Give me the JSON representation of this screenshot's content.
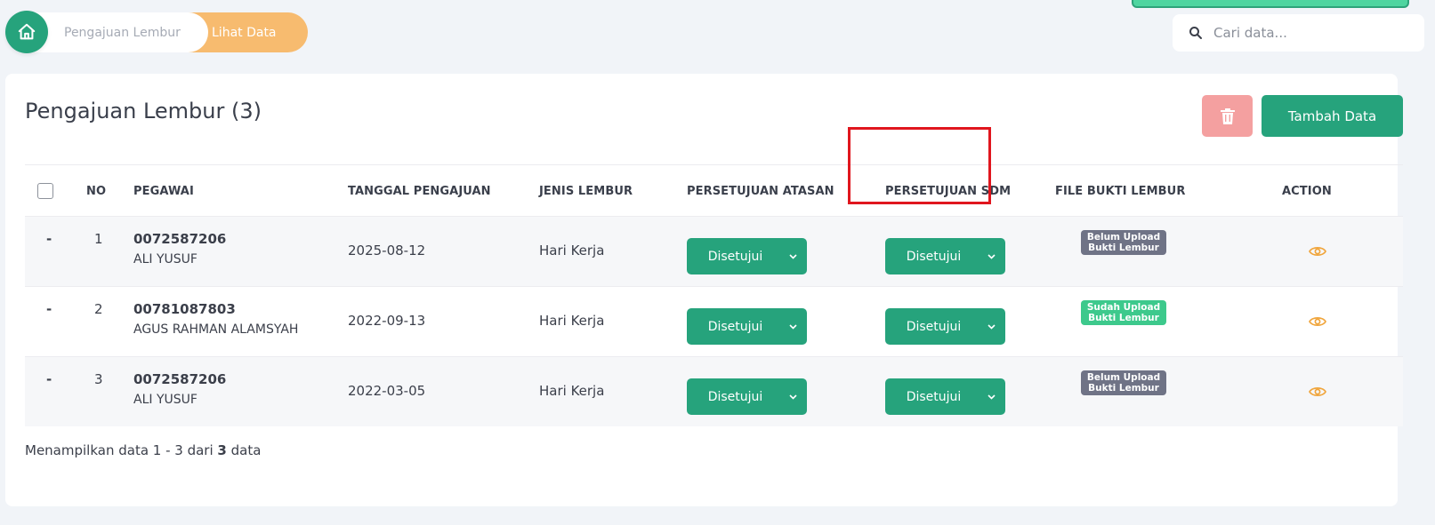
{
  "breadcrumb": {
    "items": [
      {
        "label": "Pengajuan Lembur"
      },
      {
        "label": "Lihat Data"
      }
    ]
  },
  "search": {
    "placeholder": "Cari data..."
  },
  "page": {
    "title": "Pengajuan Lembur (3)",
    "add_button_label": "Tambah Data"
  },
  "table": {
    "headers": {
      "no": "NO",
      "pegawai": "PEGAWAI",
      "tanggal": "TANGGAL PENGAJUAN",
      "jenis": "JENIS LEMBUR",
      "atasan": "PERSETUJUAN ATASAN",
      "sdm": "PERSETUJUAN SDM",
      "bukti": "FILE BUKTI LEMBUR",
      "action": "ACTION"
    },
    "rows": [
      {
        "dash": "-",
        "no": "1",
        "id": "0072587206",
        "name": "ALI YUSUF",
        "date": "2025-08-12",
        "type": "Hari Kerja",
        "atasan": "Disetujui",
        "sdm": "Disetujui",
        "bukti_line1": "Belum Upload",
        "bukti_line2": "Bukti Lembur",
        "bukti_status": "belum"
      },
      {
        "dash": "-",
        "no": "2",
        "id": "00781087803",
        "name": "AGUS RAHMAN ALAMSYAH",
        "date": "2022-09-13",
        "type": "Hari Kerja",
        "atasan": "Disetujui",
        "sdm": "Disetujui",
        "bukti_line1": "Sudah Upload",
        "bukti_line2": "Bukti Lembur",
        "bukti_status": "sudah"
      },
      {
        "dash": "-",
        "no": "3",
        "id": "0072587206",
        "name": "ALI YUSUF",
        "date": "2022-03-05",
        "type": "Hari Kerja",
        "atasan": "Disetujui",
        "sdm": "Disetujui",
        "bukti_line1": "Belum Upload",
        "bukti_line2": "Bukti Lembur",
        "bukti_status": "belum"
      }
    ]
  },
  "footer": {
    "prefix": "Menampilkan data 1 - 3 dari",
    "total": "3",
    "suffix": "data"
  },
  "colors": {
    "primary": "#26a37c",
    "breadcrumb_active": "#f7bb6f",
    "delete": "#f4a0a0",
    "badge_belum": "#6f7386",
    "badge_sudah": "#3dc98c",
    "eye_icon": "#f0a53c",
    "highlight": "#e0161e"
  },
  "icons": {
    "home": "home-icon",
    "search": "search-icon",
    "delete": "trash-icon",
    "dropdown": "chevron-down-icon",
    "view": "eye-icon"
  }
}
